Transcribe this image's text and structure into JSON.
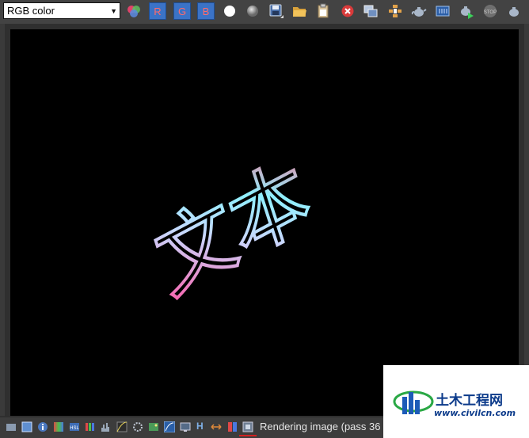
{
  "toolbar": {
    "channel_select": {
      "value": "RGB color"
    },
    "channel_buttons": {
      "r": "R",
      "g": "G",
      "b": "B"
    }
  },
  "viewport": {
    "rendered_text": "文本"
  },
  "statusbar": {
    "h_label": "H",
    "status": "Rendering image (pass 36"
  },
  "watermark": {
    "title": "土木工程网",
    "url": "www.civilcn.com"
  },
  "colors": {
    "toolbar_bg": "#434343",
    "viewport_bg": "#000000",
    "channel_button": "#3b73c7",
    "text_gradient_start": "#ff4fa0",
    "text_gradient_end": "#8ef0ff"
  }
}
